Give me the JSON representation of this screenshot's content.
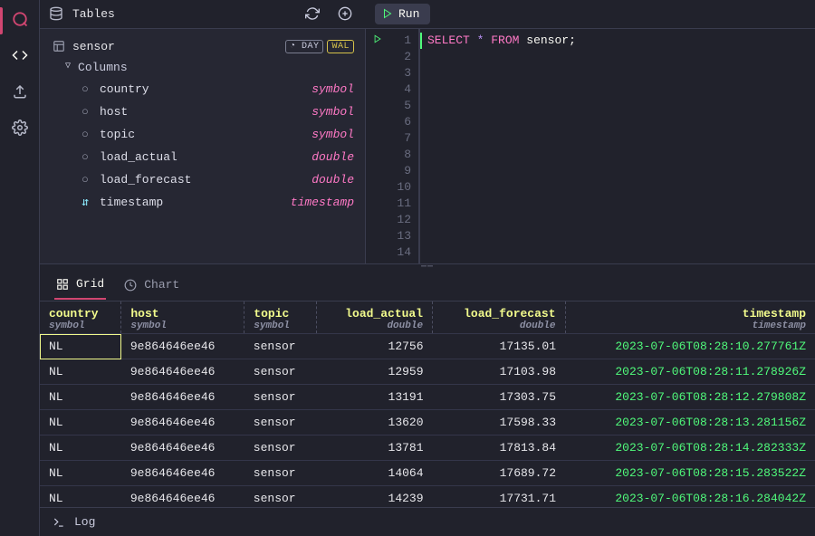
{
  "rail": {
    "items": [
      "logo",
      "code",
      "upload",
      "settings"
    ]
  },
  "topbar": {
    "title": "Tables",
    "run_label": "Run"
  },
  "schema": {
    "table_name": "sensor",
    "badge_partition": "DAY",
    "badge_wal": "WAL",
    "columns_label": "Columns",
    "columns": [
      {
        "name": "country",
        "type": "symbol",
        "designated": false
      },
      {
        "name": "host",
        "type": "symbol",
        "designated": false
      },
      {
        "name": "topic",
        "type": "symbol",
        "designated": false
      },
      {
        "name": "load_actual",
        "type": "double",
        "designated": false
      },
      {
        "name": "load_forecast",
        "type": "double",
        "designated": false
      },
      {
        "name": "timestamp",
        "type": "timestamp",
        "designated": true
      }
    ]
  },
  "editor": {
    "line_count": 14,
    "sql_tokens": {
      "select": "SELECT",
      "star": "*",
      "from": "FROM",
      "table": "sensor",
      "semi": ";"
    }
  },
  "result_tabs": {
    "grid": "Grid",
    "chart": "Chart"
  },
  "grid": {
    "columns": [
      {
        "name": "country",
        "type": "symbol",
        "align": "left"
      },
      {
        "name": "host",
        "type": "symbol",
        "align": "left"
      },
      {
        "name": "topic",
        "type": "symbol",
        "align": "left"
      },
      {
        "name": "load_actual",
        "type": "double",
        "align": "right"
      },
      {
        "name": "load_forecast",
        "type": "double",
        "align": "right"
      },
      {
        "name": "timestamp",
        "type": "timestamp",
        "align": "right"
      }
    ],
    "rows": [
      [
        "NL",
        "9e864646ee46",
        "sensor",
        "12756",
        "17135.01",
        "2023-07-06T08:28:10.277761Z"
      ],
      [
        "NL",
        "9e864646ee46",
        "sensor",
        "12959",
        "17103.98",
        "2023-07-06T08:28:11.278926Z"
      ],
      [
        "NL",
        "9e864646ee46",
        "sensor",
        "13191",
        "17303.75",
        "2023-07-06T08:28:12.279808Z"
      ],
      [
        "NL",
        "9e864646ee46",
        "sensor",
        "13620",
        "17598.33",
        "2023-07-06T08:28:13.281156Z"
      ],
      [
        "NL",
        "9e864646ee46",
        "sensor",
        "13781",
        "17813.84",
        "2023-07-06T08:28:14.282333Z"
      ],
      [
        "NL",
        "9e864646ee46",
        "sensor",
        "14064",
        "17689.72",
        "2023-07-06T08:28:15.283522Z"
      ],
      [
        "NL",
        "9e864646ee46",
        "sensor",
        "14239",
        "17731.71",
        "2023-07-06T08:28:16.284042Z"
      ]
    ]
  },
  "log": {
    "label": "Log"
  }
}
